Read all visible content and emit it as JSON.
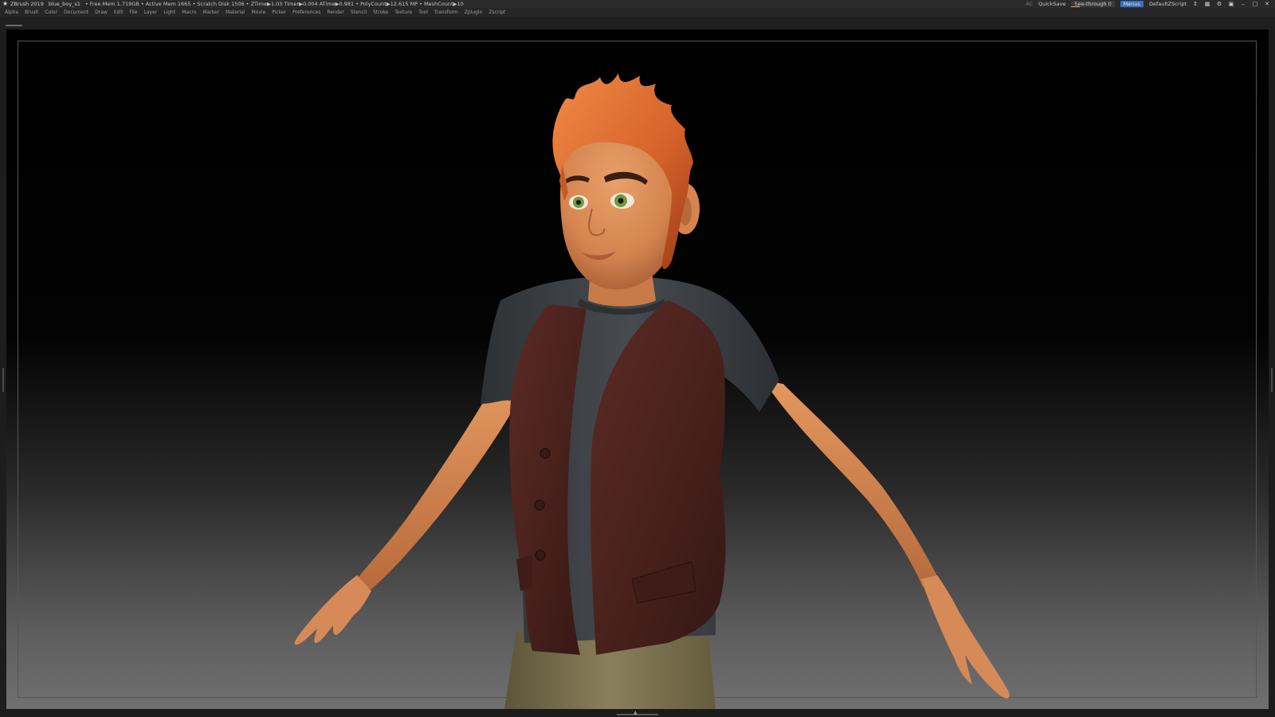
{
  "titlebar": {
    "app_name": "ZBrush 2019",
    "document_name": "blue_boy_s1",
    "stats": "• Free Mem 1.719GB • Active Mem 1665 • Scratch Disk 1506 • ZTime▶1.03 Timer▶0.004 ATime▶0.981 • PolyCount▶12.615 MP • MeshCount▶10",
    "ac_label": "AC",
    "quicksave_label": "QuickSave",
    "see_through_label": "See-through",
    "see_through_value": "0",
    "menus_label": "Menus",
    "script_label": "DefaultZScript"
  },
  "menubar": {
    "items": [
      "Alpha",
      "Brush",
      "Color",
      "Document",
      "Draw",
      "Edit",
      "File",
      "Layer",
      "Light",
      "Macro",
      "Marker",
      "Material",
      "Movie",
      "Picker",
      "Preferences",
      "Render",
      "Stencil",
      "Stroke",
      "Texture",
      "Tool",
      "Transform",
      "Zplugin",
      "Zscript"
    ]
  },
  "colors": {
    "accent": "#3d6fb6",
    "slider": "#e8a23a",
    "skin": "#d98a55",
    "hair": "#e0672a",
    "vest": "#4e2420",
    "tshirt": "#3b3e42",
    "pants": "#7c7151",
    "iris": "#6f9a3a"
  },
  "icons": {
    "app": "zbrush-logo-icon",
    "window": [
      "layout-icon",
      "palette-icon",
      "lock-icon",
      "minimize-icon",
      "maximize-icon",
      "close-icon"
    ]
  }
}
